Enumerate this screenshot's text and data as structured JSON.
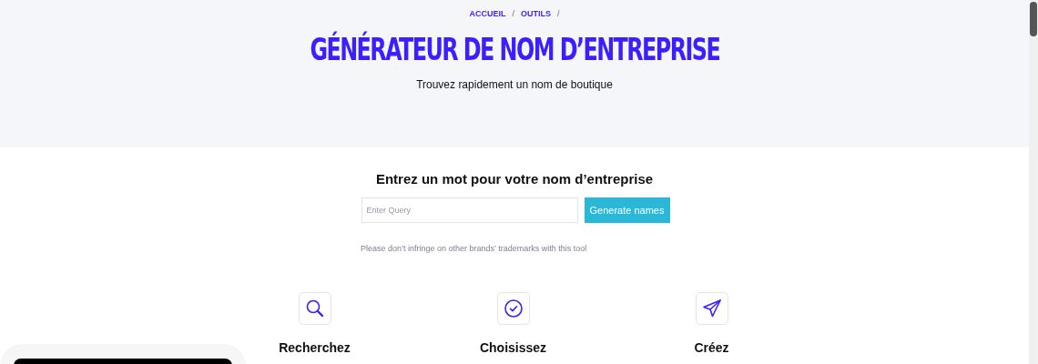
{
  "breadcrumb": [
    {
      "label": "ACCUEIL"
    },
    {
      "label": "OUTILS"
    }
  ],
  "breadcrumb_separator": "/",
  "title": "GÉNÉRATEUR DE NOM D’ENTREPRISE",
  "subtitle": "Trouvez rapidement un nom de boutique",
  "form": {
    "heading": "Entrez un mot pour votre nom d’entreprise",
    "placeholder": "Enter Query",
    "button": "Generate names",
    "note": "Please don’t infringe on other brands’ trademarks with this tool"
  },
  "features": [
    {
      "kind": "search",
      "label": "Recherchez"
    },
    {
      "kind": "check",
      "label": "Choisissez"
    },
    {
      "kind": "send",
      "label": "Créez"
    }
  ]
}
